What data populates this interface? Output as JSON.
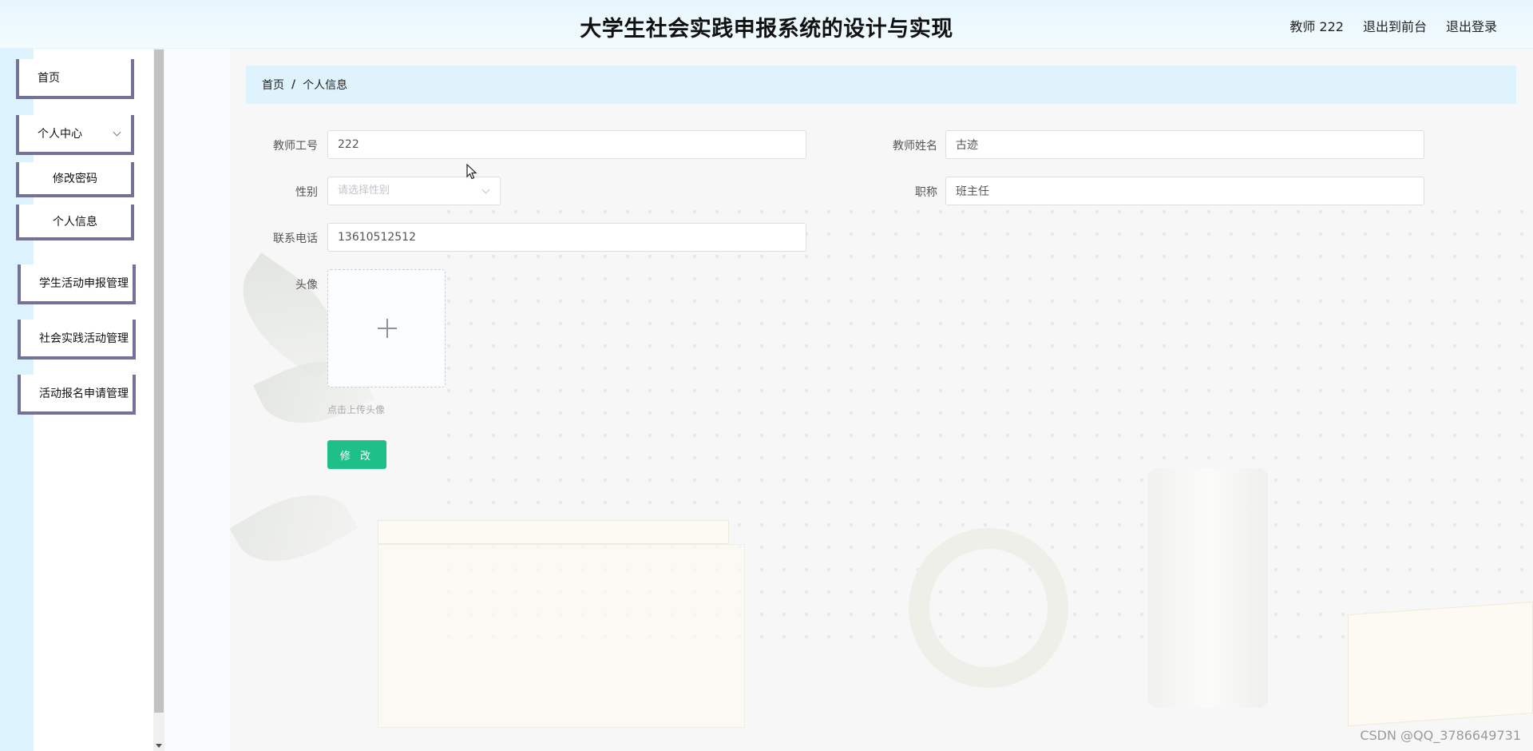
{
  "header": {
    "title": "大学生社会实践申报系统的设计与实现",
    "user_label": "教师 222",
    "to_frontend": "退出到前台",
    "logout": "退出登录"
  },
  "sidebar": {
    "items": [
      {
        "label": "首页"
      },
      {
        "label": "个人中心"
      },
      {
        "label": "修改密码"
      },
      {
        "label": "个人信息"
      },
      {
        "label": "学生活动申报管理"
      },
      {
        "label": "社会实践活动管理"
      },
      {
        "label": "活动报名申请管理"
      }
    ]
  },
  "breadcrumb": {
    "home": "首页",
    "separator": "/",
    "current": "个人信息"
  },
  "form": {
    "teacher_id": {
      "label": "教师工号",
      "value": "222"
    },
    "teacher_name": {
      "label": "教师姓名",
      "value": "古迹"
    },
    "gender": {
      "label": "性别",
      "placeholder": "请选择性别"
    },
    "job_title": {
      "label": "职称",
      "value": "班主任"
    },
    "phone": {
      "label": "联系电话",
      "value": "13610512512"
    },
    "avatar": {
      "label": "头像",
      "tip": "点击上传头像"
    },
    "submit_label": "修 改"
  },
  "watermark": "CSDN @QQ_3786649731",
  "colors": {
    "accent": "#1fbf8a",
    "menu_border": "#737399",
    "breadcrumb_bg": "#dff3fc"
  }
}
